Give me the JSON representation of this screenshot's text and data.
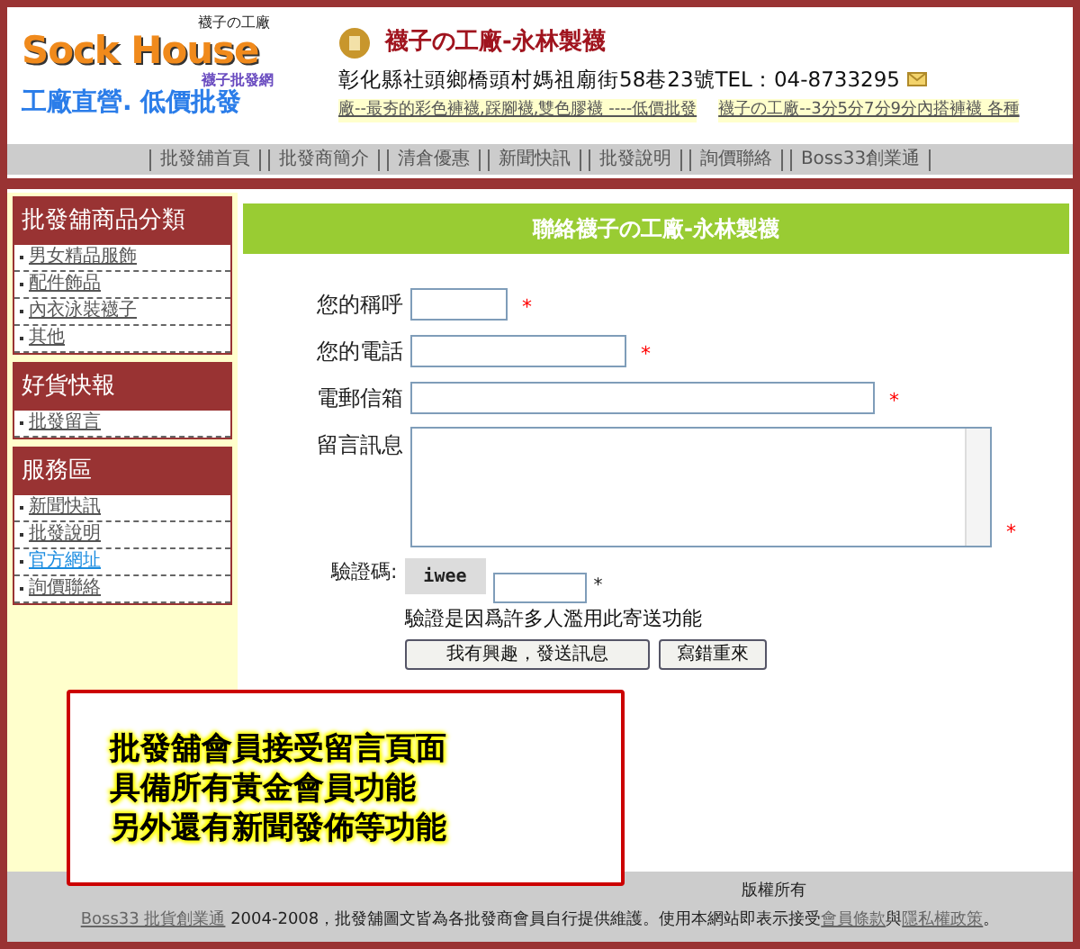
{
  "header": {
    "logo": {
      "top_tag": "襪子の工廠",
      "brand": "Sock House",
      "bottom_tag": "襪子批發網",
      "slogan": "工廠直營. 低價批發"
    },
    "company": "襪子の工廠-永林製襪",
    "address": "彰化縣社頭鄉橋頭村媽祖廟街58巷23號TEL：04-8733295",
    "tickers": [
      "廠--最夯的彩色褲襪,踩腳襪,雙色膠襪 ----低價批發",
      "襪子の工廠--3分5分7分9分內搭褲襪 各種"
    ]
  },
  "nav": [
    "批發舖首頁",
    "批發商簡介",
    "清倉優惠",
    "新聞快訊",
    "批發說明",
    "詢價聯絡",
    "Boss33創業通"
  ],
  "sidebar": [
    {
      "title": "批發舖商品分類",
      "items": [
        {
          "label": "男女精品服飾",
          "active": false
        },
        {
          "label": "配件飾品",
          "active": false
        },
        {
          "label": "內衣泳裝襪子",
          "active": false
        },
        {
          "label": "其他",
          "active": false
        }
      ]
    },
    {
      "title": "好貨快報",
      "items": [
        {
          "label": "批發留言",
          "active": false
        }
      ]
    },
    {
      "title": "服務區",
      "items": [
        {
          "label": "新聞快訊",
          "active": false
        },
        {
          "label": "批發說明",
          "active": false
        },
        {
          "label": "官方網址",
          "active": true
        },
        {
          "label": "詢價聯絡",
          "active": false
        }
      ]
    }
  ],
  "main": {
    "title": "聯絡襪子の工廠-永林製襪",
    "required_mark": "*",
    "fields": [
      {
        "label": "您的稱呼",
        "kind": "text",
        "required": true
      },
      {
        "label": "您的電話",
        "kind": "text",
        "required": true
      },
      {
        "label": "電郵信箱",
        "kind": "text",
        "required": true
      },
      {
        "label": "留言訊息",
        "kind": "textarea",
        "required": true
      }
    ],
    "captcha": {
      "label": "驗證碼:",
      "code": "iwee",
      "required": true,
      "note": "驗證是因爲許多人濫用此寄送功能"
    },
    "buttons": [
      "我有興趣，發送訊息",
      "寫錯重來"
    ]
  },
  "callout": {
    "lines": [
      "批發舖會員接受留言頁面",
      "具備所有黃金會員功能",
      "另外還有新聞發佈等功能"
    ]
  },
  "footer": {
    "notice": "版權所有",
    "parts": [
      {
        "text": "Boss33 批貨創業通",
        "kind": "link"
      },
      {
        "text": " 2004-2008，批發舖圖文皆為各批發商會員自行提供維護。使用本網站即表示接受",
        "kind": "text"
      },
      {
        "text": "會員條款",
        "kind": "link"
      },
      {
        "text": "與",
        "kind": "text"
      },
      {
        "text": "隱私權政策",
        "kind": "link"
      },
      {
        "text": "。",
        "kind": "text"
      }
    ]
  }
}
